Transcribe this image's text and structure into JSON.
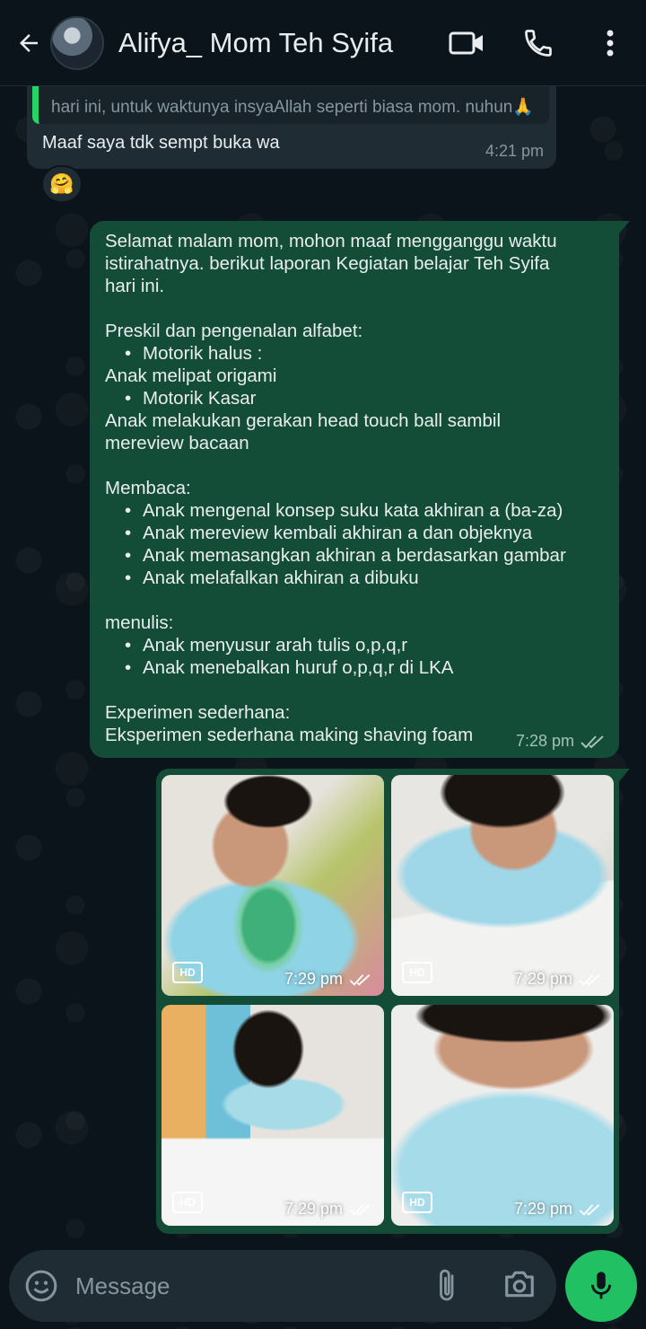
{
  "header": {
    "contact_name": "Alifya_ Mom Teh Syifa",
    "icons": [
      "back-arrow-icon",
      "video-call-icon",
      "phone-icon",
      "more-vert-icon"
    ]
  },
  "incoming": {
    "quote_text": "hari ini, untuk waktunya insyaAllah seperti biasa mom. nuhun🙏",
    "text": "Maaf saya tdk sempt buka wa",
    "time": "4:21 pm",
    "reaction": "🤗"
  },
  "outgoing": {
    "lines": [
      {
        "type": "text",
        "text": "Selamat malam mom, mohon maaf mengganggu waktu"
      },
      {
        "type": "text",
        "text": "istirahatnya. berikut laporan Kegiatan belajar Teh Syifa"
      },
      {
        "type": "text",
        "text": "hari ini."
      },
      {
        "type": "blank",
        "text": ""
      },
      {
        "type": "text",
        "text": "Preskil dan pengenalan alfabet:"
      },
      {
        "type": "bullet",
        "text": "Motorik halus :"
      },
      {
        "type": "text",
        "text": "Anak melipat origami"
      },
      {
        "type": "bullet",
        "text": "Motorik Kasar"
      },
      {
        "type": "text",
        "text": "Anak melakukan gerakan head touch ball sambil"
      },
      {
        "type": "text",
        "text": "mereview bacaan"
      },
      {
        "type": "blank",
        "text": ""
      },
      {
        "type": "text",
        "text": "Membaca:"
      },
      {
        "type": "bullet",
        "text": "Anak mengenal konsep suku kata akhiran a (ba-za)"
      },
      {
        "type": "bullet",
        "text": "Anak mereview kembali akhiran a dan objeknya"
      },
      {
        "type": "bullet",
        "text": "Anak memasangkan akhiran a berdasarkan gambar"
      },
      {
        "type": "bullet",
        "text": "Anak melafalkan akhiran a dibuku"
      },
      {
        "type": "blank",
        "text": ""
      },
      {
        "type": "text",
        "text": "menulis:"
      },
      {
        "type": "bullet",
        "text": "Anak menyusur arah tulis o,p,q,r"
      },
      {
        "type": "bullet",
        "text": "Anak menebalkan huruf o,p,q,r di LKA"
      },
      {
        "type": "blank",
        "text": ""
      },
      {
        "type": "text",
        "text": "Experimen sederhana:"
      },
      {
        "type": "text",
        "text": "Eksperimen sederhana making shaving foam"
      }
    ],
    "bullet_char": "•",
    "time": "7:28 pm",
    "status": "read"
  },
  "media": {
    "photos": [
      {
        "time": "7:29 pm",
        "hd": "HD",
        "scene": "child-with-green-cup"
      },
      {
        "time": "7:29 pm",
        "hd": "HD",
        "scene": "child-with-worksheet"
      },
      {
        "time": "7:29 pm",
        "hd": "HD",
        "scene": "child-writing-on-board"
      },
      {
        "time": "7:29 pm",
        "hd": "HD",
        "scene": "child-close-up"
      }
    ]
  },
  "composer": {
    "placeholder": "Message",
    "value": ""
  },
  "colors": {
    "background": "#0b141a",
    "incoming_bubble": "#1f2c33",
    "outgoing_bubble": "#134d37",
    "accent": "#21c063",
    "quote_bar": "#25d366"
  }
}
